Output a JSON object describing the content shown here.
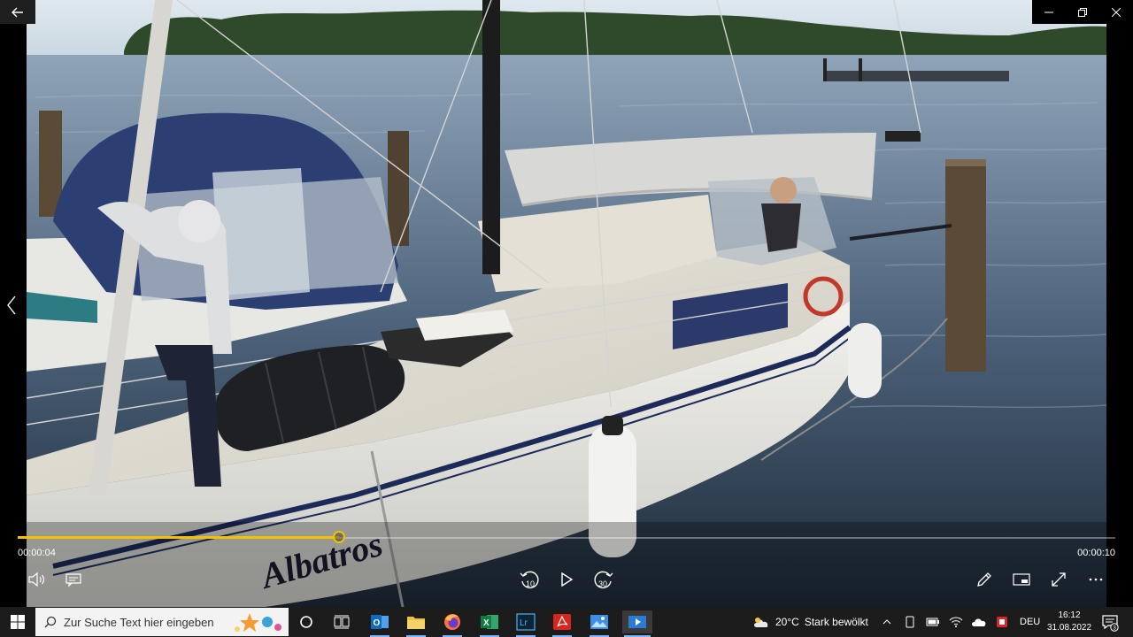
{
  "window": {
    "back_icon": "arrow-left-icon",
    "controls": [
      "minimize-icon",
      "restore-icon",
      "close-icon"
    ]
  },
  "photo": {
    "boat_name": "Albatros"
  },
  "player": {
    "current_time": "00:00:04",
    "total_time": "00:00:10",
    "progress": 0.293,
    "accent_color": "#f2c200",
    "controls_left": [
      "volume-icon",
      "subtitles-icon"
    ],
    "controls_center": [
      {
        "name": "rewind-10-icon",
        "label": "10"
      },
      {
        "name": "play-icon",
        "label": ""
      },
      {
        "name": "forward-30-icon",
        "label": "30"
      }
    ],
    "controls_right": [
      "edit-pencil-icon",
      "mini-view-icon",
      "fullscreen-icon",
      "more-icon"
    ]
  },
  "taskbar": {
    "search_placeholder": "Zur Suche Text hier eingeben",
    "pinned_apps": [
      "cortana-icon",
      "task-view-icon",
      "outlook-icon",
      "file-explorer-icon",
      "firefox-icon",
      "excel-icon",
      "lightroom-icon",
      "acrobat-icon",
      "photos-icon",
      "media-player-icon"
    ],
    "lightroom_label": "Lr",
    "excel_label": "X",
    "outlook_label": "O",
    "weather_temp": "20°C",
    "weather_desc": "Stark bewölkt",
    "language": "DEU",
    "time": "16:12",
    "date": "31.08.2022",
    "notification_count": "3"
  }
}
